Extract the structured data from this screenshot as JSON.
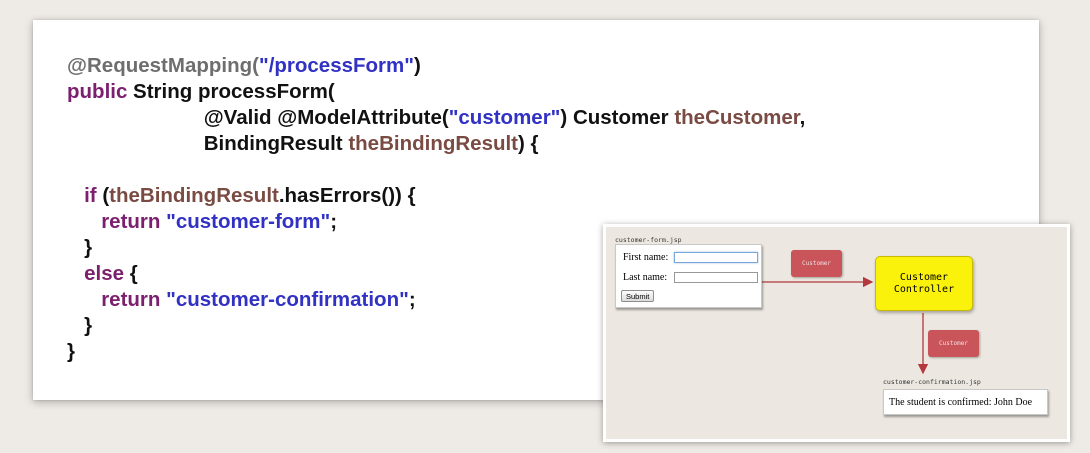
{
  "code": {
    "lines": [
      [
        {
          "t": "@RequestMapping(",
          "c": "ann"
        },
        {
          "t": "\"/processForm\"",
          "c": "str"
        },
        {
          "t": ")",
          "c": "plain"
        }
      ],
      [
        {
          "t": "public",
          "c": "kw"
        },
        {
          "t": " String processForm(",
          "c": "plain"
        }
      ],
      [
        {
          "t": "                        @Valid @ModelAttribute(",
          "c": "plain"
        },
        {
          "t": "\"customer\"",
          "c": "str"
        },
        {
          "t": ") Customer ",
          "c": "plain"
        },
        {
          "t": "theCustomer",
          "c": "var"
        },
        {
          "t": ",",
          "c": "plain"
        }
      ],
      [
        {
          "t": "                        BindingResult ",
          "c": "plain"
        },
        {
          "t": "theBindingResult",
          "c": "var"
        },
        {
          "t": ") {",
          "c": "plain"
        }
      ],
      [],
      [
        {
          "t": "   ",
          "c": "plain"
        },
        {
          "t": "if",
          "c": "kw"
        },
        {
          "t": " (",
          "c": "plain"
        },
        {
          "t": "theBindingResult",
          "c": "var"
        },
        {
          "t": ".hasErrors()) {",
          "c": "plain"
        }
      ],
      [
        {
          "t": "      ",
          "c": "plain"
        },
        {
          "t": "return",
          "c": "kw"
        },
        {
          "t": " ",
          "c": "plain"
        },
        {
          "t": "\"customer-form\"",
          "c": "str"
        },
        {
          "t": ";",
          "c": "plain"
        }
      ],
      [
        {
          "t": "   }",
          "c": "plain"
        }
      ],
      [
        {
          "t": "   ",
          "c": "plain"
        },
        {
          "t": "else",
          "c": "kw"
        },
        {
          "t": " {",
          "c": "plain"
        }
      ],
      [
        {
          "t": "      ",
          "c": "plain"
        },
        {
          "t": "return",
          "c": "kw"
        },
        {
          "t": " ",
          "c": "plain"
        },
        {
          "t": "\"customer-confirmation\"",
          "c": "str"
        },
        {
          "t": ";",
          "c": "plain"
        }
      ],
      [
        {
          "t": "   }",
          "c": "plain"
        }
      ],
      [
        {
          "t": "}",
          "c": "plain"
        }
      ]
    ]
  },
  "colors": {
    "annotation": "#6e6e6e",
    "keyword": "#7b1f6e",
    "string": "#3131c4",
    "variable": "#7a4b43",
    "arrow": "#b3393f",
    "controller": "#fbf20b",
    "model_box": "#c9545a"
  },
  "diagram": {
    "form_file_label": "customer-form.jsp",
    "first_name_label": "First name:",
    "last_name_label": "Last name:",
    "submit_label": "Submit",
    "customer_box_top": "Customer",
    "controller_label_line1": "Customer",
    "controller_label_line2": "Controller",
    "customer_box_bottom": "Customer",
    "confirmation_file_label": "customer-confirmation.jsp",
    "confirmation_text": "The student is confirmed: John Doe"
  }
}
